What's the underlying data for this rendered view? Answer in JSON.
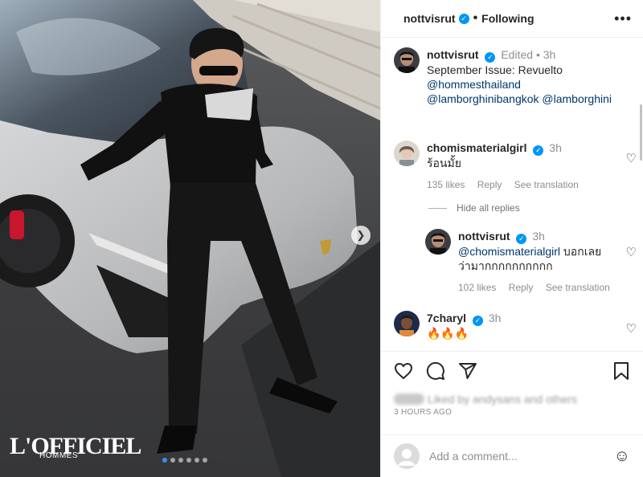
{
  "header": {
    "username": "nottvisrut",
    "verified_icon": "verified-badge-icon",
    "separator": "•",
    "follow_state": "Following",
    "more_icon": "more-options-icon"
  },
  "photo": {
    "watermark_main": "L'OFFICIEL",
    "watermark_sub": "HOMMES",
    "next_icon": "chevron-right-icon",
    "slide_count": 6,
    "active_slide": 1
  },
  "caption": {
    "username": "nottvisrut",
    "edited": "Edited",
    "dot": "•",
    "time": "3h",
    "text": "September Issue: Revuelto",
    "mentions": [
      "@hommesthailand",
      "@lamborghinibangkok",
      "@lamborghini"
    ]
  },
  "comments": [
    {
      "username": "chomismaterialgirl",
      "time": "3h",
      "text": "ร้อนมั้ย",
      "likes": "135 likes",
      "reply": "Reply",
      "translate": "See translation"
    },
    {
      "username": "nottvisrut",
      "time": "3h",
      "mention": "@chomismaterialgirl",
      "text_1": "บอกเลย",
      "text_2": "ว่ามากกกกกกกกกก",
      "likes": "102 likes",
      "reply": "Reply",
      "translate": "See translation"
    },
    {
      "username": "7charyl",
      "time": "3h",
      "text": "🔥🔥🔥"
    }
  ],
  "hide_replies": "Hide all replies",
  "actions": {
    "like_icon": "heart-icon",
    "comment_icon": "comment-icon",
    "share_icon": "share-icon",
    "save_icon": "bookmark-icon"
  },
  "likes_summary": "Liked by andysans and others",
  "post_time": "3 HOURS AGO",
  "add_comment": {
    "placeholder": "Add a comment...",
    "emoji_icon": "emoji-icon"
  },
  "colors": {
    "verified": "#0095f6",
    "active_dot": "#3d8bfd",
    "link": "#00376b"
  }
}
